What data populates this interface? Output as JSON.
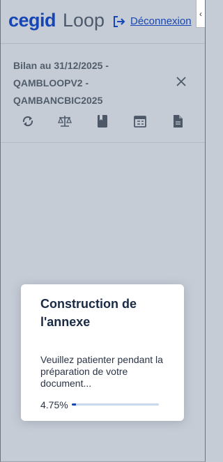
{
  "header": {
    "brand_primary": "cegid",
    "brand_secondary": "Loop",
    "logout_label": "Déconnexion",
    "logout_icon": "logout-icon",
    "collapse_glyph": "‹"
  },
  "document": {
    "title": "Bilan au 31/12/2025 - QAMBLOOPV2 - QAMBANCBIC2025"
  },
  "toolbar": {
    "items": [
      {
        "icon": "refresh-icon"
      },
      {
        "icon": "balance-scale-icon"
      },
      {
        "icon": "book-icon"
      },
      {
        "icon": "calendar-icon"
      },
      {
        "icon": "document-icon"
      }
    ]
  },
  "modal": {
    "title": "Construction de l'annexe",
    "message": "Veuillez patienter pendant la préparation de votre document...",
    "progress_text": "4.75%",
    "progress_value": 0.0475
  },
  "colors": {
    "brand_blue": "#1646b5",
    "brand_gray": "#4c5a6b",
    "overlay_bg": "#c5ccd6",
    "icon_color": "#4c5868"
  }
}
